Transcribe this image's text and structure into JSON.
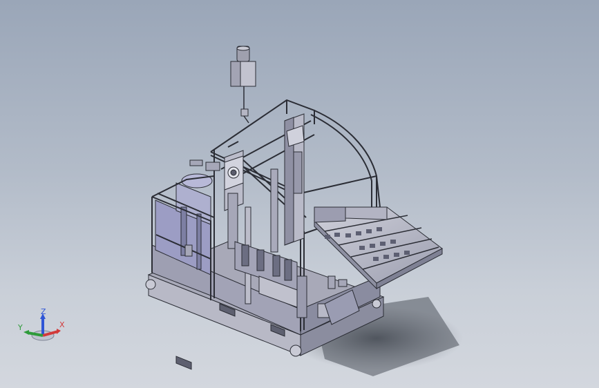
{
  "viewport": {
    "background_top": "#9aa6b8",
    "background_bottom": "#d3d7de"
  },
  "triad": {
    "x_label": "X",
    "y_label": "Y",
    "z_label": "Z",
    "x_color": "#d23a3a",
    "y_color": "#2e9b3a",
    "z_color": "#2f56d6"
  },
  "model": {
    "icon": "3d-cad-assembly-icon",
    "colors": {
      "line": "#2b2d35",
      "light_face": "#c7c8d3",
      "mid_face": "#a4a6b6",
      "dark_face": "#7d7f92",
      "interior": "#9fa0c2",
      "shadow": "#4a4f58"
    }
  }
}
